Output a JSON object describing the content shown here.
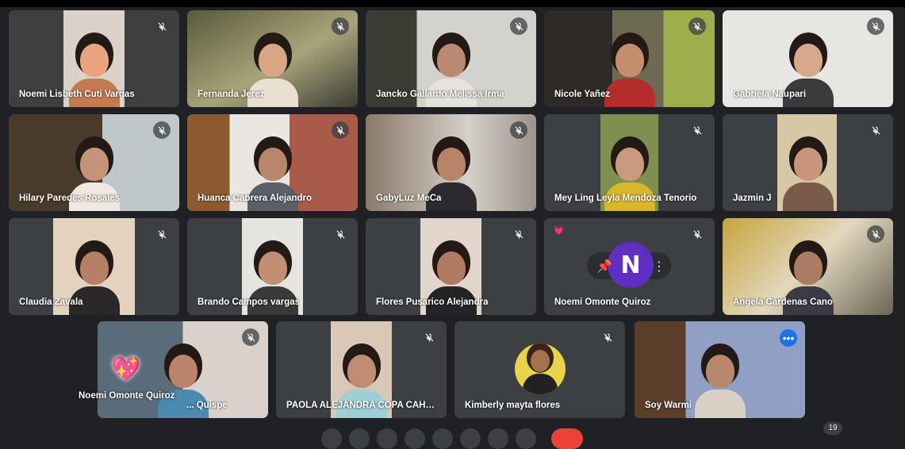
{
  "participants": [
    {
      "name": "Noemi Lisbeth Cuti Vargas"
    },
    {
      "name": "Fernanda Jerez"
    },
    {
      "name": "Jancko Gallardo Melissa Irma"
    },
    {
      "name": "Nicole Yañez"
    },
    {
      "name": "Gabriela Naupari"
    },
    {
      "name": "Hilary Paredes Rosales"
    },
    {
      "name": "Huanca Cabrera Alejandro"
    },
    {
      "name": "GabyLuz MeCa"
    },
    {
      "name": "Mey Ling Leyla Mendoza Tenorio"
    },
    {
      "name": "Jazmin J"
    },
    {
      "name": "Claudia Zavala"
    },
    {
      "name": "Brando Campos vargas"
    },
    {
      "name": "Flores Pusarico Alejandra"
    },
    {
      "name": "Noemi Omonte Quiroz",
      "avatar_letter": "N"
    },
    {
      "name": "Ángela Cárdenas Cano"
    },
    {
      "name": "... Quispe"
    },
    {
      "name": "PAOLA ALEJANDRA COPA CAHU..."
    },
    {
      "name": "Kimberly mayta flores"
    },
    {
      "name": "Soy Warmi"
    }
  ],
  "reaction_overlay": {
    "name": "Noemi Omonte Quiroz",
    "emoji": "heart-sparkle"
  },
  "participant_count": "19",
  "colors": {
    "background": "#202124",
    "tile": "#3c4043",
    "accent": "#1a73e8",
    "avatar_n": "#5e2fc2"
  }
}
